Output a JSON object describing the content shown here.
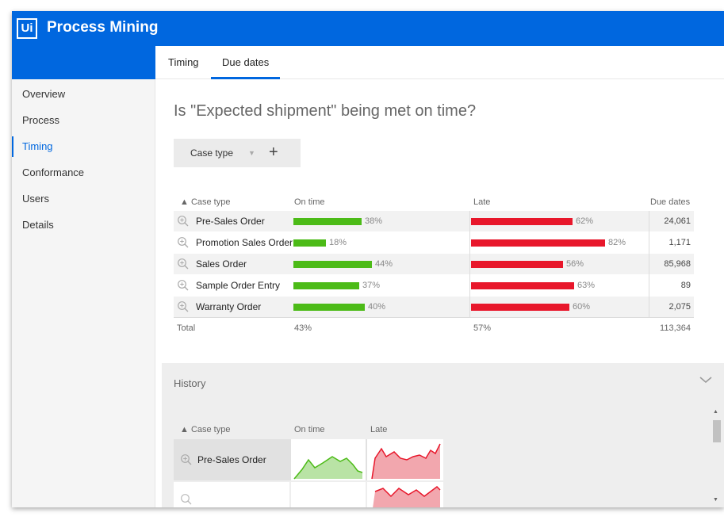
{
  "app": {
    "logo_text": "Ui",
    "title": "Process Mining"
  },
  "tabs": [
    {
      "label": "Timing"
    },
    {
      "label": "Due dates"
    }
  ],
  "sidebar": {
    "items": [
      {
        "label": "Overview"
      },
      {
        "label": "Process"
      },
      {
        "label": "Timing"
      },
      {
        "label": "Conformance"
      },
      {
        "label": "Users"
      },
      {
        "label": "Details"
      }
    ]
  },
  "question": "Is \"Expected shipment\" being met on time?",
  "filter": {
    "label": "Case type",
    "plus": "+"
  },
  "table": {
    "headers": {
      "case_type": "▲ Case type",
      "on_time": "On time",
      "late": "Late",
      "due_dates": "Due dates"
    },
    "rows": [
      {
        "case": "Pre-Sales Order",
        "on_time_label": "38%",
        "late_label": "62%",
        "on_time": 0.38,
        "late": 0.62,
        "due": "24,061"
      },
      {
        "case": "Promotion Sales Order",
        "on_time_label": "18%",
        "late_label": "82%",
        "on_time": 0.18,
        "late": 0.82,
        "due": "1,171"
      },
      {
        "case": "Sales Order",
        "on_time_label": "44%",
        "late_label": "56%",
        "on_time": 0.44,
        "late": 0.56,
        "due": "85,968"
      },
      {
        "case": "Sample Order Entry",
        "on_time_label": "37%",
        "late_label": "63%",
        "on_time": 0.37,
        "late": 0.63,
        "due": "89"
      },
      {
        "case": "Warranty Order",
        "on_time_label": "40%",
        "late_label": "60%",
        "on_time": 0.4,
        "late": 0.6,
        "due": "2,075"
      }
    ],
    "total": {
      "label": "Total",
      "on_time": "43%",
      "late": "57%",
      "due": "113,364"
    }
  },
  "history": {
    "title": "History",
    "headers": {
      "case_type": "▲ Case type",
      "on_time": "On time",
      "late": "Late"
    },
    "rows": [
      {
        "case": "Pre-Sales Order"
      }
    ]
  },
  "colors": {
    "primary": "#0067df",
    "on_time": "#4cbb17",
    "late": "#e8172b"
  }
}
